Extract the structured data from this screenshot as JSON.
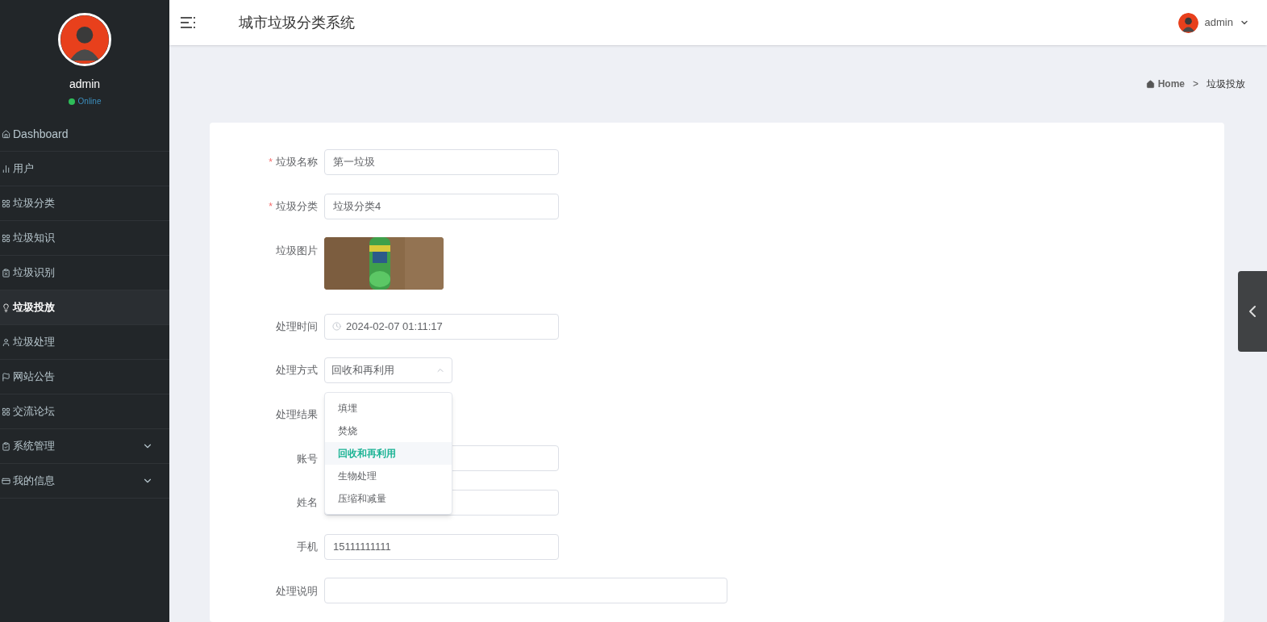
{
  "sidebar": {
    "user": {
      "name": "admin",
      "status": "Online"
    },
    "items": [
      {
        "label": "Dashboard",
        "selected": false,
        "expandable": false
      },
      {
        "label": "用户",
        "selected": false,
        "expandable": false
      },
      {
        "label": "垃圾分类",
        "selected": false,
        "expandable": false
      },
      {
        "label": "垃圾知识",
        "selected": false,
        "expandable": false
      },
      {
        "label": "垃圾识别",
        "selected": false,
        "expandable": false
      },
      {
        "label": "垃圾投放",
        "selected": true,
        "expandable": false
      },
      {
        "label": "垃圾处理",
        "selected": false,
        "expandable": false
      },
      {
        "label": "网站公告",
        "selected": false,
        "expandable": false
      },
      {
        "label": "交流论坛",
        "selected": false,
        "expandable": false
      },
      {
        "label": "系统管理",
        "selected": false,
        "expandable": true
      },
      {
        "label": "我的信息",
        "selected": false,
        "expandable": true
      }
    ]
  },
  "header": {
    "title": "城市垃圾分类系统",
    "user": "admin"
  },
  "breadcrumb": [
    {
      "label": "Home"
    },
    {
      "label": ">"
    },
    {
      "label": "垃圾投放"
    }
  ],
  "form": {
    "fields": [
      {
        "kind": "input",
        "label": "垃圾名称",
        "required_mark": "*",
        "value": "第一垃圾"
      },
      {
        "kind": "input",
        "label": "垃圾分类",
        "required_mark": "*",
        "value": "垃圾分类4"
      },
      {
        "label": "垃圾图片"
      },
      {
        "kind": "datetime",
        "label": "处理时间",
        "value": "2024-02-07 01:11:17"
      },
      {
        "kind": "select",
        "label": "处理方式",
        "value": "回收和再利用",
        "open": true,
        "options": [
          {
            "label": "填埋",
            "selected": false
          },
          {
            "label": "焚烧",
            "selected": false
          },
          {
            "label": "回收和再利用",
            "selected": true
          },
          {
            "label": "生物处理",
            "selected": false
          },
          {
            "label": "压缩和减量",
            "selected": false
          }
        ]
      },
      {
        "kind": "hidden",
        "label": "处理结果"
      },
      {
        "kind": "input",
        "label": "账号"
      },
      {
        "kind": "input",
        "label": "姓名"
      },
      {
        "kind": "input",
        "label": "手机",
        "value": "15111111111"
      },
      {
        "kind": "textarea",
        "label": "处理说明"
      }
    ]
  }
}
